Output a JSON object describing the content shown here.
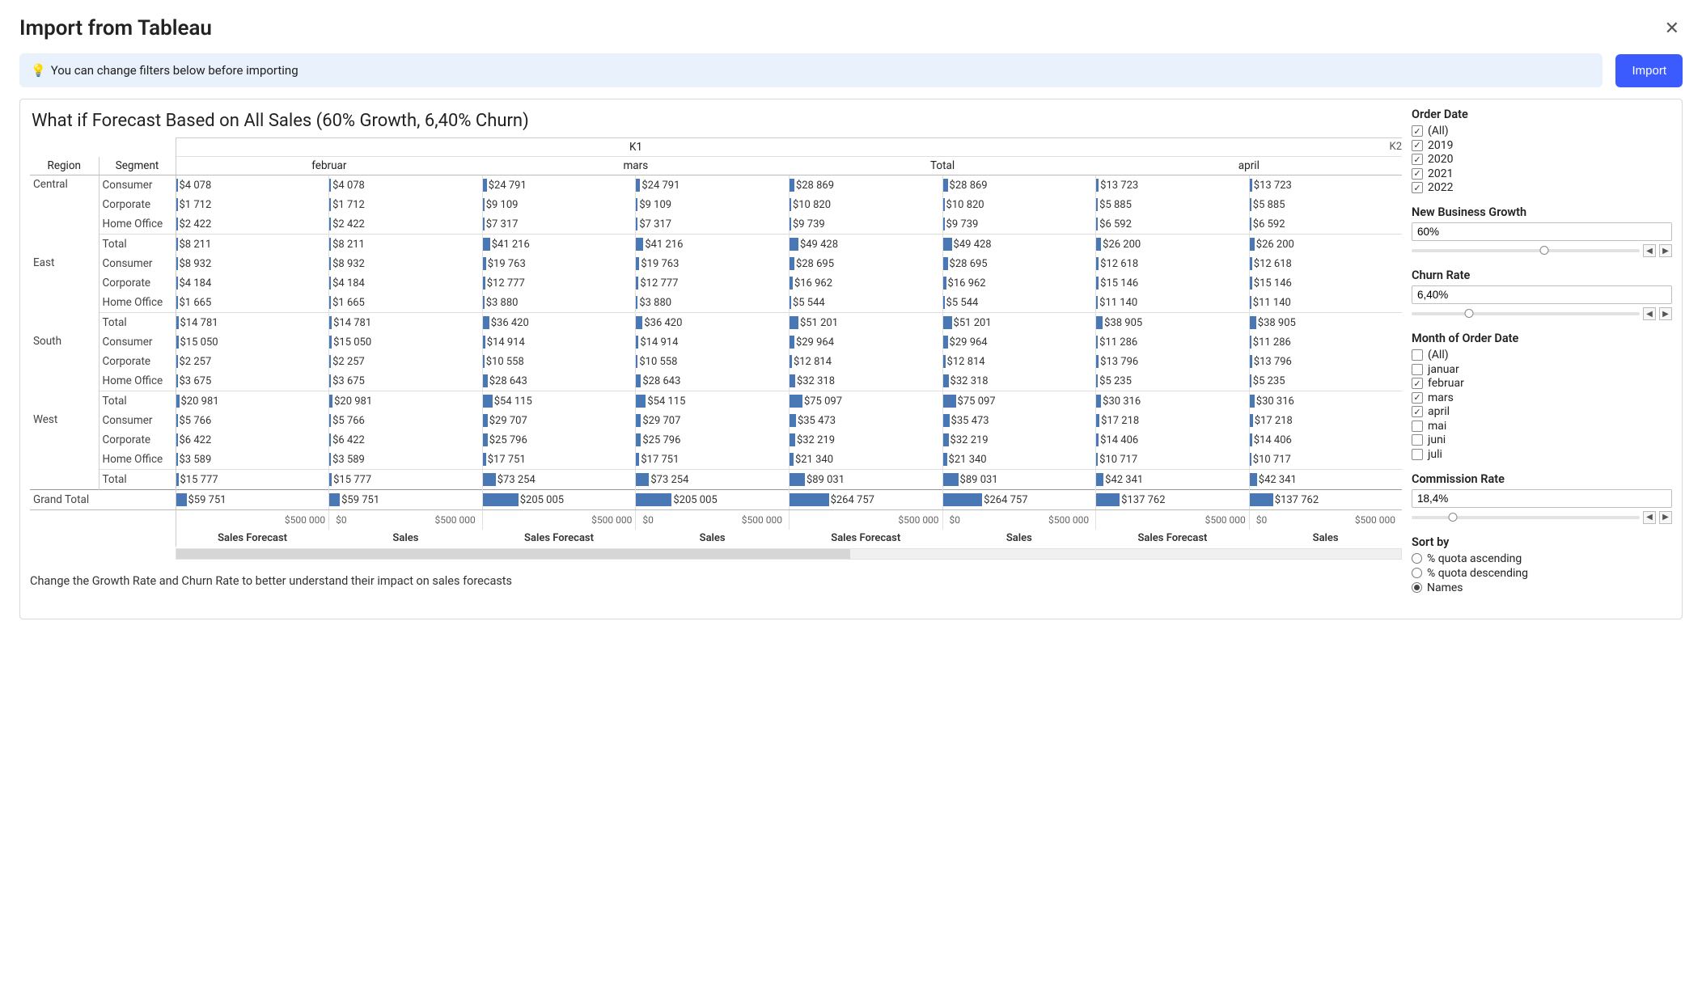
{
  "header": {
    "title": "Import from Tableau"
  },
  "banner": {
    "icon": "💡",
    "text": "You can change filters below before importing"
  },
  "import_btn": "Import",
  "chart_title": "What if Forecast Based on All Sales (60% Growth, 6,40% Churn)",
  "footer_hint": "Change the Growth Rate and Churn Rate to better understand their impact on sales forecasts",
  "cols": {
    "region": "Region",
    "segment": "Segment",
    "quarter": "K1",
    "quarter_next": "K2",
    "months": [
      "februar",
      "mars",
      "Total",
      "april"
    ],
    "metrics": [
      "Sales Forecast",
      "Sales",
      "Sales Forecast",
      "Sales",
      "Sales Forecast",
      "Sales",
      "Sales Forecast",
      "Sales"
    ],
    "axis_left": "$500 000",
    "axis_zero": "$0",
    "axis_right": "$500 000"
  },
  "regions": [
    {
      "name": "Central",
      "rows": [
        {
          "seg": "Consumer",
          "v": [
            "$4 078",
            "$4 078",
            "$24 791",
            "$24 791",
            "$28 869",
            "$28 869",
            "$13 723",
            "$13 723"
          ]
        },
        {
          "seg": "Corporate",
          "v": [
            "$1 712",
            "$1 712",
            "$9 109",
            "$9 109",
            "$10 820",
            "$10 820",
            "$5 885",
            "$5 885"
          ]
        },
        {
          "seg": "Home Office",
          "v": [
            "$2 422",
            "$2 422",
            "$7 317",
            "$7 317",
            "$9 739",
            "$9 739",
            "$6 592",
            "$6 592"
          ]
        },
        {
          "seg": "Total",
          "v": [
            "$8 211",
            "$8 211",
            "$41 216",
            "$41 216",
            "$49 428",
            "$49 428",
            "$26 200",
            "$26 200"
          ],
          "total": true
        }
      ]
    },
    {
      "name": "East",
      "rows": [
        {
          "seg": "Consumer",
          "v": [
            "$8 932",
            "$8 932",
            "$19 763",
            "$19 763",
            "$28 695",
            "$28 695",
            "$12 618",
            "$12 618"
          ]
        },
        {
          "seg": "Corporate",
          "v": [
            "$4 184",
            "$4 184",
            "$12 777",
            "$12 777",
            "$16 962",
            "$16 962",
            "$15 146",
            "$15 146"
          ]
        },
        {
          "seg": "Home Office",
          "v": [
            "$1 665",
            "$1 665",
            "$3 880",
            "$3 880",
            "$5 544",
            "$5 544",
            "$11 140",
            "$11 140"
          ]
        },
        {
          "seg": "Total",
          "v": [
            "$14 781",
            "$14 781",
            "$36 420",
            "$36 420",
            "$51 201",
            "$51 201",
            "$38 905",
            "$38 905"
          ],
          "total": true
        }
      ]
    },
    {
      "name": "South",
      "rows": [
        {
          "seg": "Consumer",
          "v": [
            "$15 050",
            "$15 050",
            "$14 914",
            "$14 914",
            "$29 964",
            "$29 964",
            "$11 286",
            "$11 286"
          ]
        },
        {
          "seg": "Corporate",
          "v": [
            "$2 257",
            "$2 257",
            "$10 558",
            "$10 558",
            "$12 814",
            "$12 814",
            "$13 796",
            "$13 796"
          ]
        },
        {
          "seg": "Home Office",
          "v": [
            "$3 675",
            "$3 675",
            "$28 643",
            "$28 643",
            "$32 318",
            "$32 318",
            "$5 235",
            "$5 235"
          ]
        },
        {
          "seg": "Total",
          "v": [
            "$20 981",
            "$20 981",
            "$54 115",
            "$54 115",
            "$75 097",
            "$75 097",
            "$30 316",
            "$30 316"
          ],
          "total": true
        }
      ]
    },
    {
      "name": "West",
      "rows": [
        {
          "seg": "Consumer",
          "v": [
            "$5 766",
            "$5 766",
            "$29 707",
            "$29 707",
            "$35 473",
            "$35 473",
            "$17 218",
            "$17 218"
          ]
        },
        {
          "seg": "Corporate",
          "v": [
            "$6 422",
            "$6 422",
            "$25 796",
            "$25 796",
            "$32 219",
            "$32 219",
            "$14 406",
            "$14 406"
          ]
        },
        {
          "seg": "Home Office",
          "v": [
            "$3 589",
            "$3 589",
            "$17 751",
            "$17 751",
            "$21 340",
            "$21 340",
            "$10 717",
            "$10 717"
          ]
        },
        {
          "seg": "Total",
          "v": [
            "$15 777",
            "$15 777",
            "$73 254",
            "$73 254",
            "$89 031",
            "$89 031",
            "$42 341",
            "$42 341"
          ],
          "total": true
        }
      ]
    }
  ],
  "grand_total": {
    "label": "Grand Total",
    "v": [
      "$59 751",
      "$59 751",
      "$205 005",
      "$205 005",
      "$264 757",
      "$264 757",
      "$137 762",
      "$137 762"
    ]
  },
  "bar_max": 500000,
  "filters": {
    "order_date": {
      "title": "Order Date",
      "items": [
        {
          "label": "(All)",
          "checked": true
        },
        {
          "label": "2019",
          "checked": true
        },
        {
          "label": "2020",
          "checked": true
        },
        {
          "label": "2021",
          "checked": true
        },
        {
          "label": "2022",
          "checked": true
        }
      ]
    },
    "growth": {
      "title": "New Business Growth",
      "value": "60%",
      "pos": 58
    },
    "churn": {
      "title": "Churn Rate",
      "value": "6,40%",
      "pos": 25
    },
    "month": {
      "title": "Month of Order Date",
      "items": [
        {
          "label": "(All)",
          "checked": false
        },
        {
          "label": "januar",
          "checked": false
        },
        {
          "label": "februar",
          "checked": true
        },
        {
          "label": "mars",
          "checked": true
        },
        {
          "label": "april",
          "checked": true
        },
        {
          "label": "mai",
          "checked": false
        },
        {
          "label": "juni",
          "checked": false
        },
        {
          "label": "juli",
          "checked": false
        }
      ]
    },
    "commission": {
      "title": "Commission Rate",
      "value": "18,4%",
      "pos": 18
    },
    "sort": {
      "title": "Sort by",
      "items": [
        {
          "label": "% quota ascending",
          "sel": false
        },
        {
          "label": "% quota descending",
          "sel": false
        },
        {
          "label": "Names",
          "sel": true
        }
      ]
    }
  },
  "chart_data": {
    "type": "table",
    "title": "What if Forecast Based on All Sales (60% Growth, 6,40% Churn)",
    "x_axis_range": [
      0,
      500000
    ],
    "columns": [
      "februar Sales Forecast",
      "februar Sales",
      "mars Sales Forecast",
      "mars Sales",
      "Total Sales Forecast",
      "Total Sales",
      "april Sales Forecast",
      "april Sales"
    ],
    "rows": [
      {
        "region": "Central",
        "segment": "Consumer",
        "values": [
          4078,
          4078,
          24791,
          24791,
          28869,
          28869,
          13723,
          13723
        ]
      },
      {
        "region": "Central",
        "segment": "Corporate",
        "values": [
          1712,
          1712,
          9109,
          9109,
          10820,
          10820,
          5885,
          5885
        ]
      },
      {
        "region": "Central",
        "segment": "Home Office",
        "values": [
          2422,
          2422,
          7317,
          7317,
          9739,
          9739,
          6592,
          6592
        ]
      },
      {
        "region": "Central",
        "segment": "Total",
        "values": [
          8211,
          8211,
          41216,
          41216,
          49428,
          49428,
          26200,
          26200
        ]
      },
      {
        "region": "East",
        "segment": "Consumer",
        "values": [
          8932,
          8932,
          19763,
          19763,
          28695,
          28695,
          12618,
          12618
        ]
      },
      {
        "region": "East",
        "segment": "Corporate",
        "values": [
          4184,
          4184,
          12777,
          12777,
          16962,
          16962,
          15146,
          15146
        ]
      },
      {
        "region": "East",
        "segment": "Home Office",
        "values": [
          1665,
          1665,
          3880,
          3880,
          5544,
          5544,
          11140,
          11140
        ]
      },
      {
        "region": "East",
        "segment": "Total",
        "values": [
          14781,
          14781,
          36420,
          36420,
          51201,
          51201,
          38905,
          38905
        ]
      },
      {
        "region": "South",
        "segment": "Consumer",
        "values": [
          15050,
          15050,
          14914,
          14914,
          29964,
          29964,
          11286,
          11286
        ]
      },
      {
        "region": "South",
        "segment": "Corporate",
        "values": [
          2257,
          2257,
          10558,
          10558,
          12814,
          12814,
          13796,
          13796
        ]
      },
      {
        "region": "South",
        "segment": "Home Office",
        "values": [
          3675,
          3675,
          28643,
          28643,
          32318,
          32318,
          5235,
          5235
        ]
      },
      {
        "region": "South",
        "segment": "Total",
        "values": [
          20981,
          20981,
          54115,
          54115,
          75097,
          75097,
          30316,
          30316
        ]
      },
      {
        "region": "West",
        "segment": "Consumer",
        "values": [
          5766,
          5766,
          29707,
          29707,
          35473,
          35473,
          17218,
          17218
        ]
      },
      {
        "region": "West",
        "segment": "Corporate",
        "values": [
          6422,
          6422,
          25796,
          25796,
          32219,
          32219,
          14406,
          14406
        ]
      },
      {
        "region": "West",
        "segment": "Home Office",
        "values": [
          3589,
          3589,
          17751,
          17751,
          21340,
          21340,
          10717,
          10717
        ]
      },
      {
        "region": "West",
        "segment": "Total",
        "values": [
          15777,
          15777,
          73254,
          73254,
          89031,
          89031,
          42341,
          42341
        ]
      },
      {
        "region": "Grand Total",
        "segment": "",
        "values": [
          59751,
          59751,
          205005,
          205005,
          264757,
          264757,
          137762,
          137762
        ]
      }
    ]
  }
}
